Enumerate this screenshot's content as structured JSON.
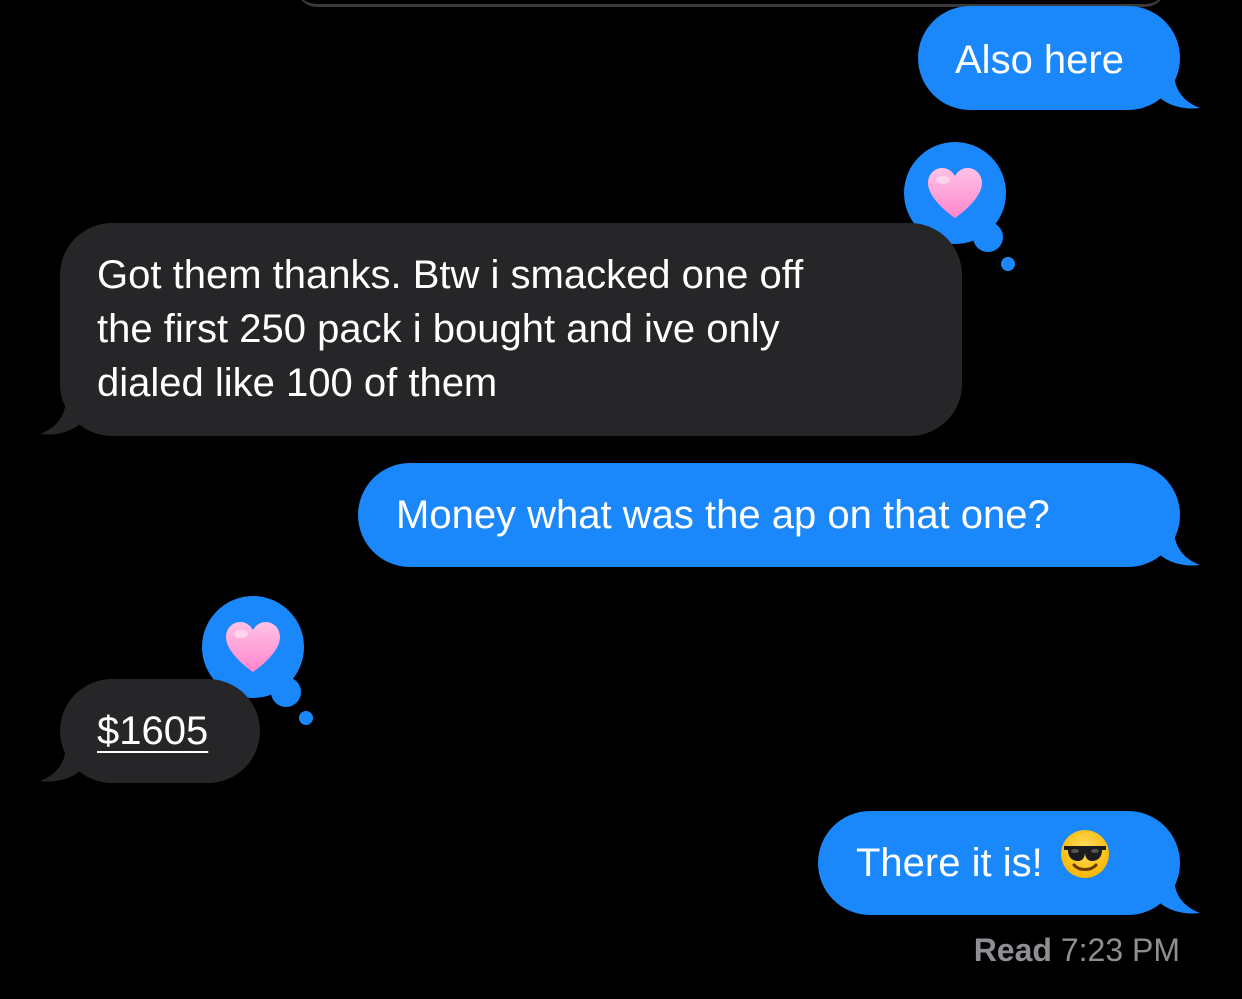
{
  "conversation": {
    "messages": [
      {
        "direction": "outgoing",
        "text": "Also here"
      },
      {
        "direction": "incoming",
        "lines": [
          "Got them thanks. Btw i smacked one off",
          "the first 250 pack i bought and ive only",
          "dialed like 100 of them"
        ],
        "reaction": "heart"
      },
      {
        "direction": "outgoing",
        "text": "Money what was the ap on that one?"
      },
      {
        "direction": "incoming",
        "text": "$1605",
        "reaction": "heart"
      },
      {
        "direction": "outgoing",
        "text": "There it is!",
        "emoji": "smiling-face-with-sunglasses"
      }
    ],
    "receipt": {
      "label": "Read",
      "time": "7:23 PM"
    }
  },
  "colors": {
    "background": "#000000",
    "outgoing_bubble": "#1a87fb",
    "incoming_bubble": "#262628",
    "text": "#ffffff",
    "receipt_text": "#8e8e93",
    "heart": "#ffa3d9"
  },
  "icons": {
    "reaction": "heart-icon",
    "emoji": "sunglasses-emoji-icon"
  }
}
